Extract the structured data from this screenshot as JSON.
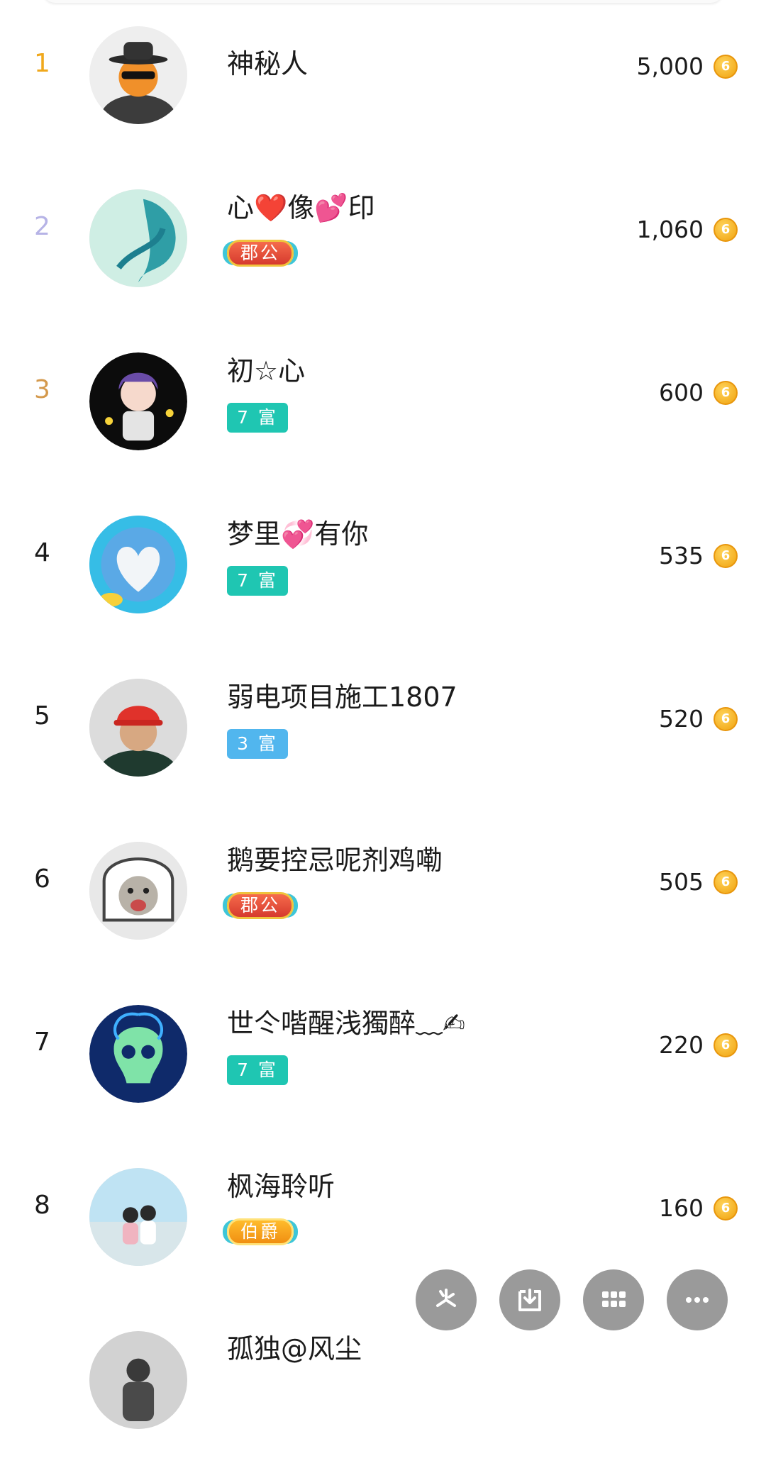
{
  "currency_icon": "coin-icon",
  "currency_glyph": "6",
  "rank_colors": {
    "1": "#f0a81c",
    "2": "#b6b3e6",
    "3": "#d4994c",
    "default": "#1b1b1b"
  },
  "rows": [
    {
      "rank": "1",
      "name": "神秘人",
      "badge": "",
      "amount": "5,000"
    },
    {
      "rank": "2",
      "name": "心❤️像💕印",
      "badge": "郡公",
      "amount": "1,060"
    },
    {
      "rank": "3",
      "name": "初☆心",
      "badge": "7 富",
      "amount": "600"
    },
    {
      "rank": "4",
      "name": "梦里💞有你",
      "badge": "7 富",
      "amount": "535"
    },
    {
      "rank": "5",
      "name": "弱电项目施工1807",
      "badge": "3 富",
      "amount": "520"
    },
    {
      "rank": "6",
      "name": "鹅要控忌呢剂鸡嘞",
      "badge": "郡公",
      "amount": "505"
    },
    {
      "rank": "7",
      "name": "世仒喈醒浅獨醉﹏✍",
      "badge": "7 富",
      "amount": "220"
    },
    {
      "rank": "8",
      "name": "枫海聆听",
      "badge": "伯爵",
      "amount": "160"
    },
    {
      "rank": "",
      "name": "孤独@风尘",
      "badge": "",
      "amount": ""
    }
  ],
  "fab_buttons": [
    {
      "icon": "pinwheel-icon"
    },
    {
      "icon": "download-icon"
    },
    {
      "icon": "grid-icon"
    },
    {
      "icon": "more-icon"
    }
  ]
}
